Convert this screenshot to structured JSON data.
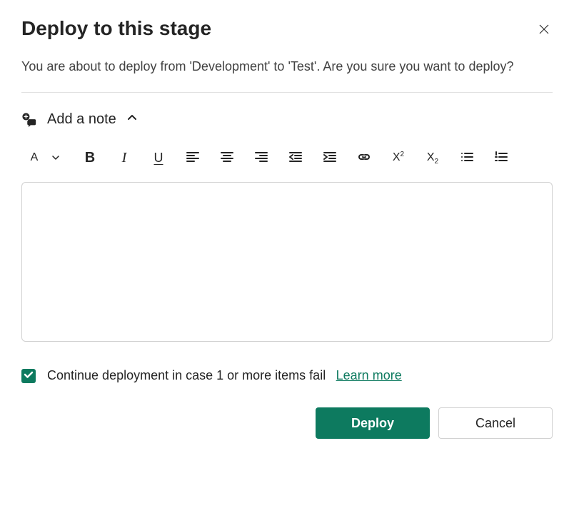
{
  "dialog": {
    "title": "Deploy to this stage",
    "description": "You are about to deploy from 'Development' to 'Test'. Are you sure you want to deploy?",
    "add_note_label": "Add a note",
    "note_value": "",
    "note_placeholder": "",
    "checkbox": {
      "checked": true,
      "label": "Continue deployment in case 1 or more items fail",
      "learn_more": "Learn more"
    },
    "buttons": {
      "primary": "Deploy",
      "secondary": "Cancel"
    }
  },
  "icons": {
    "close": "close-icon",
    "note": "note-add-icon",
    "chevron_up": "chevron-up-icon",
    "font_color": "font-color-icon",
    "font_color_caret": "caret-down-icon",
    "bold": "bold-icon",
    "italic": "italic-icon",
    "underline": "underline-icon",
    "align_left": "align-left-icon",
    "align_center": "align-center-icon",
    "align_right": "align-right-icon",
    "outdent": "outdent-icon",
    "indent": "indent-icon",
    "link": "link-icon",
    "superscript": "superscript-icon",
    "subscript": "subscript-icon",
    "bullet_list": "bullet-list-icon",
    "number_list": "number-list-icon"
  },
  "colors": {
    "primary": "#0d7a5f",
    "text": "#242424",
    "border": "#d1d1d1"
  }
}
